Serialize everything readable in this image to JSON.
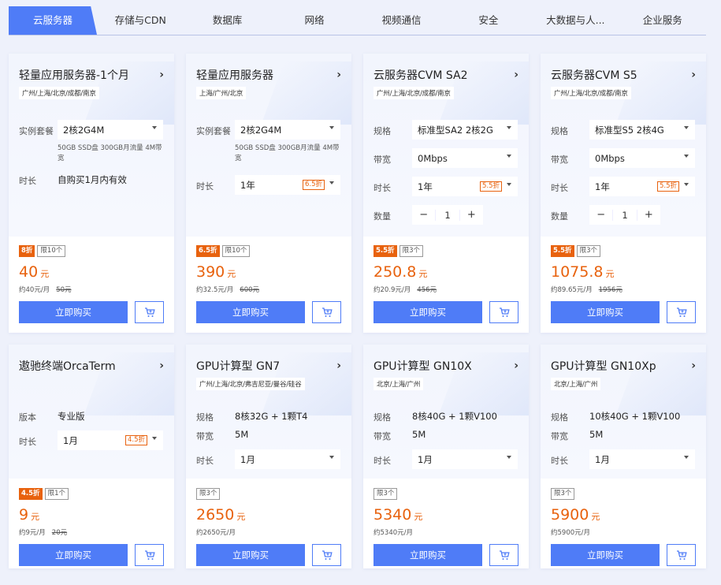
{
  "tabs": [
    "云服务器",
    "存储与CDN",
    "数据库",
    "网络",
    "视频通信",
    "安全",
    "大数据与人...",
    "企业服务"
  ],
  "buy_label": "立即购买",
  "colors": {
    "accent": "#4f7cf7",
    "price": "#e8620e"
  },
  "cards": [
    {
      "title": "轻量应用服务器-1个月",
      "regions": "广州/上海/北京/成都/南京",
      "pkg_label": "实例套餐",
      "pkg_value": "2核2G4M",
      "note": "50GB SSD盘 300GB月流量 4M带宽",
      "duration_label": "时长",
      "duration_value": "自购买1月内有效",
      "discount": "8折",
      "limit": "限10个",
      "price": "40",
      "unit": "元",
      "per": "约40元/月",
      "old": "50元"
    },
    {
      "title": "轻量应用服务器",
      "regions": "上海/广州/北京",
      "pkg_label": "实例套餐",
      "pkg_value": "2核2G4M",
      "note": "50GB SSD盘 300GB月流量 4M带宽",
      "duration_label": "时长",
      "duration_value": "1年",
      "duration_tag": "6.5折",
      "discount": "6.5折",
      "limit": "限10个",
      "price": "390",
      "unit": "元",
      "per": "约32.5元/月",
      "old": "600元"
    },
    {
      "title": "云服务器CVM SA2",
      "regions": "广州/上海/北京/成都/南京",
      "spec_label": "规格",
      "spec_value": "标准型SA2 2核2G",
      "bw_label": "带宽",
      "bw_value": "0Mbps",
      "duration_label": "时长",
      "duration_value": "1年",
      "duration_tag": "5.5折",
      "qty_label": "数量",
      "qty": "1",
      "discount": "5.5折",
      "limit": "限3个",
      "price": "250.8",
      "unit": "元",
      "per": "约20.9元/月",
      "old": "456元"
    },
    {
      "title": "云服务器CVM S5",
      "regions": "广州/上海/北京/成都/南京",
      "spec_label": "规格",
      "spec_value": "标准型S5 2核4G",
      "bw_label": "带宽",
      "bw_value": "0Mbps",
      "duration_label": "时长",
      "duration_value": "1年",
      "duration_tag": "5.5折",
      "qty_label": "数量",
      "qty": "1",
      "discount": "5.5折",
      "limit": "限3个",
      "price": "1075.8",
      "unit": "元",
      "per": "约89.65元/月",
      "old": "1956元"
    },
    {
      "title": "遨驰终端OrcaTerm",
      "edition_label": "版本",
      "edition_value": "专业版",
      "duration_label": "时长",
      "duration_value": "1月",
      "duration_tag": "4.5折",
      "discount": "4.5折",
      "limit": "限1个",
      "price": "9",
      "unit": "元",
      "per": "约9元/月",
      "old": "20元"
    },
    {
      "title": "GPU计算型 GN7",
      "regions": "广州/上海/北京/弗吉尼亚/曼谷/硅谷",
      "spec_label": "规格",
      "spec_value": "8核32G + 1颗T4",
      "bw_label": "带宽",
      "bw_value": "5M",
      "duration_label": "时长",
      "duration_value": "1月",
      "limit": "限3个",
      "price": "2650",
      "unit": "元",
      "per": "约2650元/月"
    },
    {
      "title": "GPU计算型 GN10X",
      "regions": "北京/上海/广州",
      "spec_label": "规格",
      "spec_value": "8核40G + 1颗V100",
      "bw_label": "带宽",
      "bw_value": "5M",
      "duration_label": "时长",
      "duration_value": "1月",
      "limit": "限3个",
      "price": "5340",
      "unit": "元",
      "per": "约5340元/月"
    },
    {
      "title": "GPU计算型 GN10Xp",
      "regions": "北京/上海/广州",
      "spec_label": "规格",
      "spec_value": "10核40G + 1颗V100",
      "bw_label": "带宽",
      "bw_value": "5M",
      "duration_label": "时长",
      "duration_value": "1月",
      "limit": "限3个",
      "price": "5900",
      "unit": "元",
      "per": "约5900元/月"
    }
  ]
}
